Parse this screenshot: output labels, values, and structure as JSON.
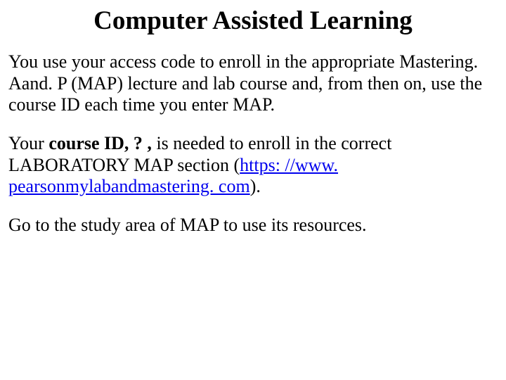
{
  "title": "Computer Assisted Learning",
  "para1": "You use your access code to enroll in the appropriate Mastering. Aand. P (MAP) lecture and lab course and, from then on, use the course ID each time you enter MAP.",
  "para2_pre": "Your ",
  "para2_bold": "course ID, ? ,",
  "para2_mid": " is needed to enroll in the correct LABORATORY MAP  section (",
  "para2_link": "https: //www. pearsonmylabandmastering. com",
  "para2_post": ").",
  "para3": "Go to the study area of MAP to use its resources."
}
